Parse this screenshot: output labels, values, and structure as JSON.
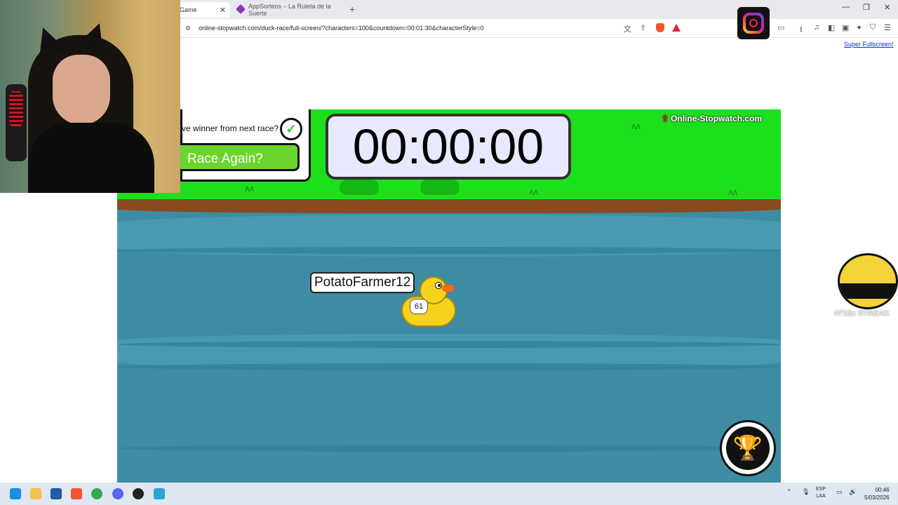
{
  "browser": {
    "active_tab_title": "Game",
    "inactive_tab_title": "AppSorteos – La Ruleta de la Suerte",
    "url": "online-stopwatch.com/duck-race/full-screen/?characters=100&countdown=00:01:30&characterStyle=0",
    "super_fullscreen_link": "Super Fullscreen!"
  },
  "game": {
    "remove_winner_text": "ve winner from next race?",
    "race_again_label": "Race Again?",
    "timer": "00:00:00",
    "logo_text": "Online-Stopwatch.com",
    "leading_duck_name": "PotatoFarmer12",
    "leading_duck_number": "61"
  },
  "overlay": {
    "streak_text": "4716x STREAK"
  },
  "taskbar": {
    "lang_top": "ESP",
    "lang_bottom": "LAA",
    "time": "00:46",
    "date": "5/03/2026"
  },
  "colors": {
    "grass": "#1de01d",
    "water": "#3d8ca3",
    "race_button": "#6bd42e",
    "timer_bg": "#e8e8ff"
  }
}
